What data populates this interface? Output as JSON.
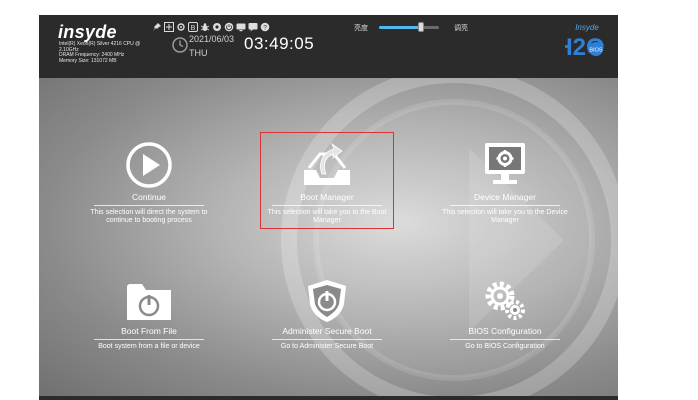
{
  "header": {
    "logo_text": "insyde",
    "cpu_info": [
      "Intel(R) Xeon(R) Silver 4216 CPU @",
      "2.10GHz",
      "DRAM Frequency: 2400 MHz",
      "Memory Size: 131072 MB"
    ],
    "date": "2021/06/03",
    "day": "THU",
    "time": "03:49:05",
    "brightness_low_label": "亮度",
    "brightness_high_label": "调亮",
    "brightness_level": 0.7,
    "brand_badge": {
      "top": "Insyde",
      "h2o": "H2O",
      "sub": "BIOS"
    },
    "toolbar_icons": [
      "pin-icon",
      "move-icon",
      "settings-icon",
      "b-icon",
      "bug-icon",
      "record-icon",
      "power-icon",
      "monitor-icon",
      "message-icon",
      "help-icon"
    ]
  },
  "menu": {
    "continue": {
      "title": "Continue",
      "desc": "This selection will direct the system to continue to booting process"
    },
    "boot_manager": {
      "title": "Boot Manager",
      "desc": "This selection will take you to the Boot Manager"
    },
    "device_manager": {
      "title": "Device Manager",
      "desc": "This selection will take you to the Device Manager"
    },
    "boot_from_file": {
      "title": "Boot From File",
      "desc": "Boot system from a file or device"
    },
    "secure_boot": {
      "title": "Administer Secure Boot",
      "desc": "Go to Administer Secure Boot"
    },
    "bios_config": {
      "title": "BIOS Configuration",
      "desc": "Go to BIOS Configuration"
    }
  },
  "selected_item": "boot_manager",
  "colors": {
    "header": "#2b2b2b",
    "accent": "#4fb8ef",
    "selection": "#e03030",
    "brand_blue": "#2f7fd6"
  }
}
